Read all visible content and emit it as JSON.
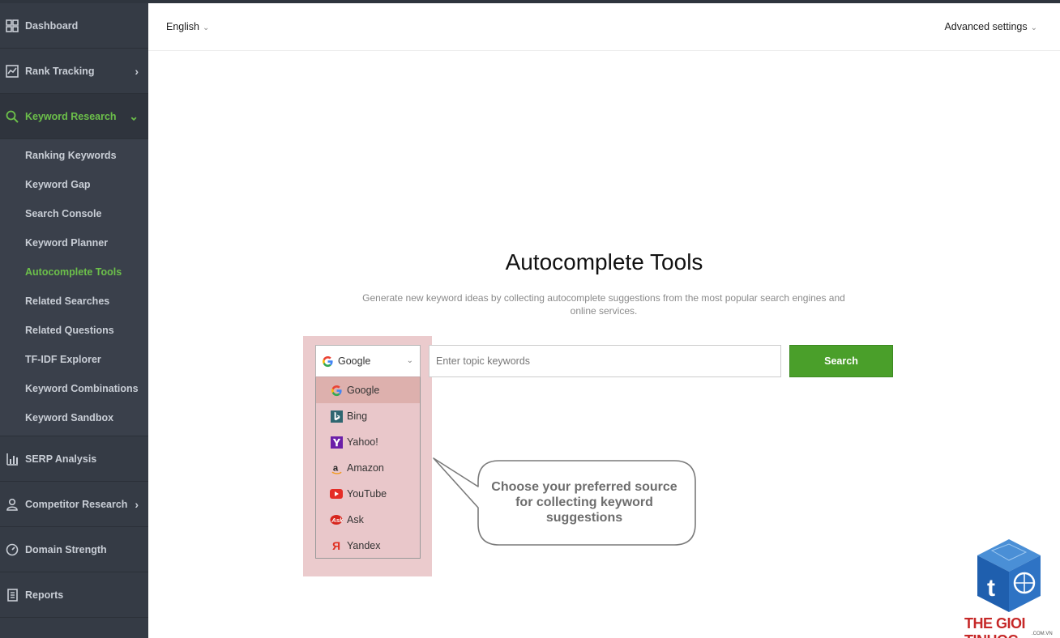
{
  "sidebar": {
    "items": [
      {
        "label": "Dashboard",
        "icon": "dashboard-grid-icon"
      },
      {
        "label": "Rank Tracking",
        "icon": "chart-line-icon"
      },
      {
        "label": "Keyword Research",
        "icon": "search-icon"
      },
      {
        "label": "SERP Analysis",
        "icon": "bar-chart-icon"
      },
      {
        "label": "Competitor Research",
        "icon": "user-icon"
      },
      {
        "label": "Domain Strength",
        "icon": "gauge-icon"
      },
      {
        "label": "Reports",
        "icon": "document-icon"
      }
    ],
    "keyword_sub": [
      "Ranking Keywords",
      "Keyword Gap",
      "Search Console",
      "Keyword Planner",
      "Autocomplete Tools",
      "Related Searches",
      "Related Questions",
      "TF-IDF Explorer",
      "Keyword Combinations",
      "Keyword Sandbox"
    ],
    "active_sub": "Autocomplete Tools"
  },
  "header": {
    "language": "English",
    "advanced": "Advanced settings"
  },
  "main": {
    "title": "Autocomplete Tools",
    "subtitle": "Generate new keyword ideas by collecting autocomplete suggestions from the most popular search engines and online services.",
    "source_selected": "Google",
    "sources": [
      "Google",
      "Bing",
      "Yahoo!",
      "Amazon",
      "YouTube",
      "Ask",
      "Yandex"
    ],
    "search_placeholder": "Enter topic keywords",
    "search_button": "Search"
  },
  "callout": {
    "text": "Choose your preferred source for collecting keyword suggestions"
  },
  "watermark": {
    "brand": "THE GIOI TINHOC",
    "domain": ".COM.VN"
  },
  "colors": {
    "sidebar_bg": "#353b45",
    "accent_green": "#6cc04a",
    "search_button": "#4a9f2a",
    "highlight": "#d28c91"
  }
}
